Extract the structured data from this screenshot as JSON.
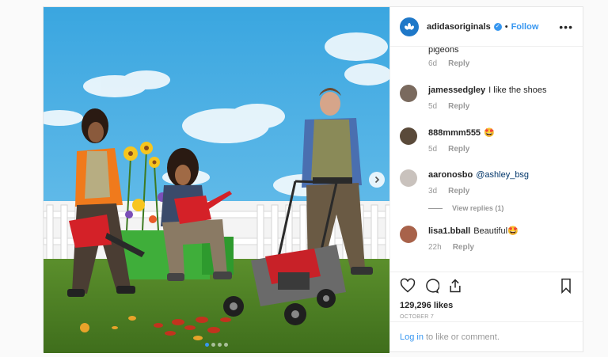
{
  "header": {
    "username": "adidasoriginals",
    "verified_icon": "verified-badge-icon",
    "separator": "•",
    "follow": "Follow",
    "more": "•••"
  },
  "media": {
    "icon": "chevron-right-icon",
    "carousel_slide": 1,
    "carousel_total": 4
  },
  "comments": {
    "cut_text": "pigeons",
    "cut_time": "6d",
    "cut_reply": "Reply",
    "items": [
      {
        "user": "jamessedgley",
        "text": "I like the shoes",
        "time": "5d",
        "reply": "Reply"
      },
      {
        "user": "888mmm555",
        "text": "🤩",
        "time": "5d",
        "reply": "Reply"
      },
      {
        "user": "aaronosbo",
        "text": "@ashley_bsg",
        "time": "3d",
        "reply": "Reply"
      },
      {
        "user": "lisa1.bball",
        "text": "Beautiful🤩",
        "time": "22h",
        "reply": "Reply"
      }
    ],
    "view_replies": "View replies (1)"
  },
  "actions": {
    "like_icon": "heart-icon",
    "comment_icon": "comment-icon",
    "share_icon": "share-icon",
    "save_icon": "bookmark-icon",
    "likes": "129,296 likes",
    "date": "OCTOBER 7"
  },
  "login": {
    "link": "Log in",
    "text": "to like or comment."
  },
  "colors": {
    "accent": "#3897f0",
    "text": "#262626",
    "muted": "#999999",
    "brand_avatar": "#1f78c8"
  }
}
